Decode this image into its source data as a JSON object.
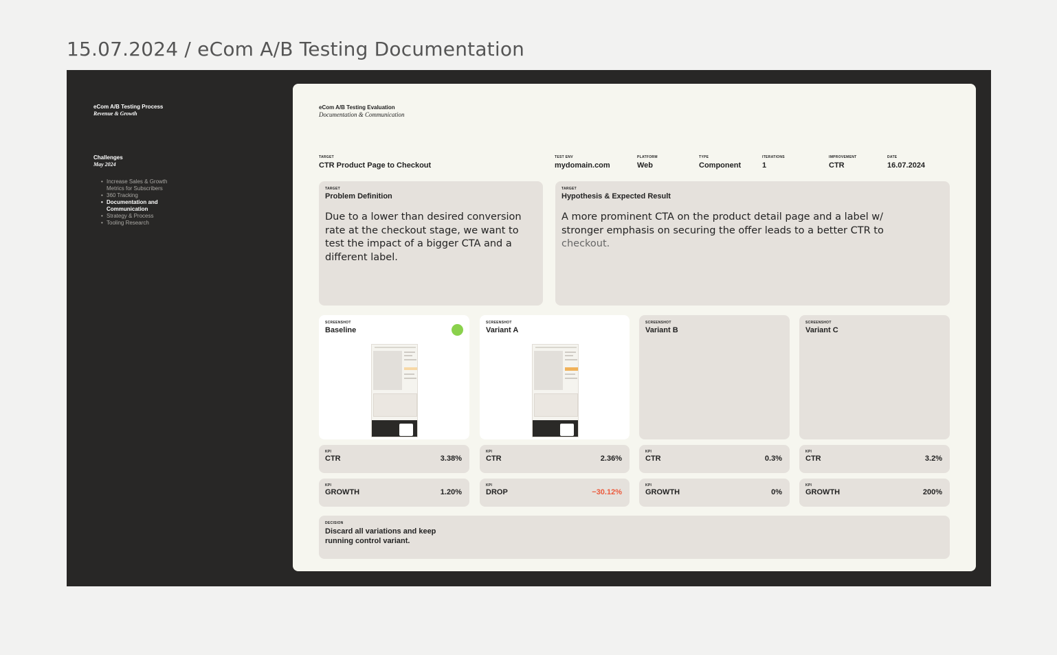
{
  "page_title": "15.07.2024 / eCom A/B Testing Documentation",
  "sidebar": {
    "title": "eCom A/B Testing Process",
    "subtitle": "Revenue & Growth",
    "section": "Challenges",
    "section_date": "May 2024",
    "items": [
      {
        "label": "Increase Sales & Growth Metrics for Subscribers",
        "active": false
      },
      {
        "label": "360 Tracking",
        "active": false
      },
      {
        "label": "Documentation and Communication",
        "active": true
      },
      {
        "label": "Strategy & Process",
        "active": false
      },
      {
        "label": "Tooling Research",
        "active": false
      }
    ]
  },
  "doc": {
    "title": "eCom A/B Testing Evaluation",
    "subtitle": "Documentation & Communication",
    "meta": {
      "target": {
        "label": "TARGET",
        "value": "CTR Product Page to Checkout"
      },
      "test_env": {
        "label": "TEST ENV",
        "value": "mydomain.com"
      },
      "platform": {
        "label": "PLATFORM",
        "value": "Web"
      },
      "type": {
        "label": "TYPE",
        "value": "Component"
      },
      "iterations": {
        "label": "ITERATIONS",
        "value": "1"
      },
      "improvement": {
        "label": "IMPROVEMENT",
        "value": "CTR"
      },
      "date": {
        "label": "DATE",
        "value": "16.07.2024"
      }
    },
    "problem": {
      "label": "TARGET",
      "title": "Problem Definition",
      "body": "Due to a lower than desired conversion rate at the checkout stage, we want to test the impact of a bigger CTA and a different label."
    },
    "hypothesis": {
      "label": "TARGET",
      "title": "Hypothesis & Expected Result",
      "body": "A more prominent CTA on the product detail page and a label w/ stronger emphasis on securing the offer leads to a better CTR to",
      "body_end": "checkout."
    },
    "variants": [
      {
        "label": "SCREENSHOT",
        "title": "Baseline",
        "winner_color": "#8ad14c",
        "kpi1": {
          "label": "KPI",
          "name": "CTR",
          "value": "3.38%"
        },
        "kpi2": {
          "label": "KPI",
          "name": "GROWTH",
          "value": "1.20%"
        }
      },
      {
        "label": "SCREENSHOT",
        "title": "Variant A",
        "kpi1": {
          "label": "KPI",
          "name": "CTR",
          "value": "2.36%"
        },
        "kpi2": {
          "label": "KPI",
          "name": "DROP",
          "value": "−30.12%",
          "color": "#ec5a3c"
        }
      },
      {
        "label": "SCREENSHOT",
        "title": "Variant B",
        "kpi1": {
          "label": "KPI",
          "name": "CTR",
          "value": "0.3%"
        },
        "kpi2": {
          "label": "KPI",
          "name": "GROWTH",
          "value": "0%"
        }
      },
      {
        "label": "SCREENSHOT",
        "title": "Variant C",
        "kpi1": {
          "label": "KPI",
          "name": "CTR",
          "value": "3.2%"
        },
        "kpi2": {
          "label": "KPI",
          "name": "GROWTH",
          "value": "200%"
        }
      }
    ],
    "decision": {
      "label": "DECISION",
      "text": "Discard all variations and keep running control variant."
    }
  }
}
